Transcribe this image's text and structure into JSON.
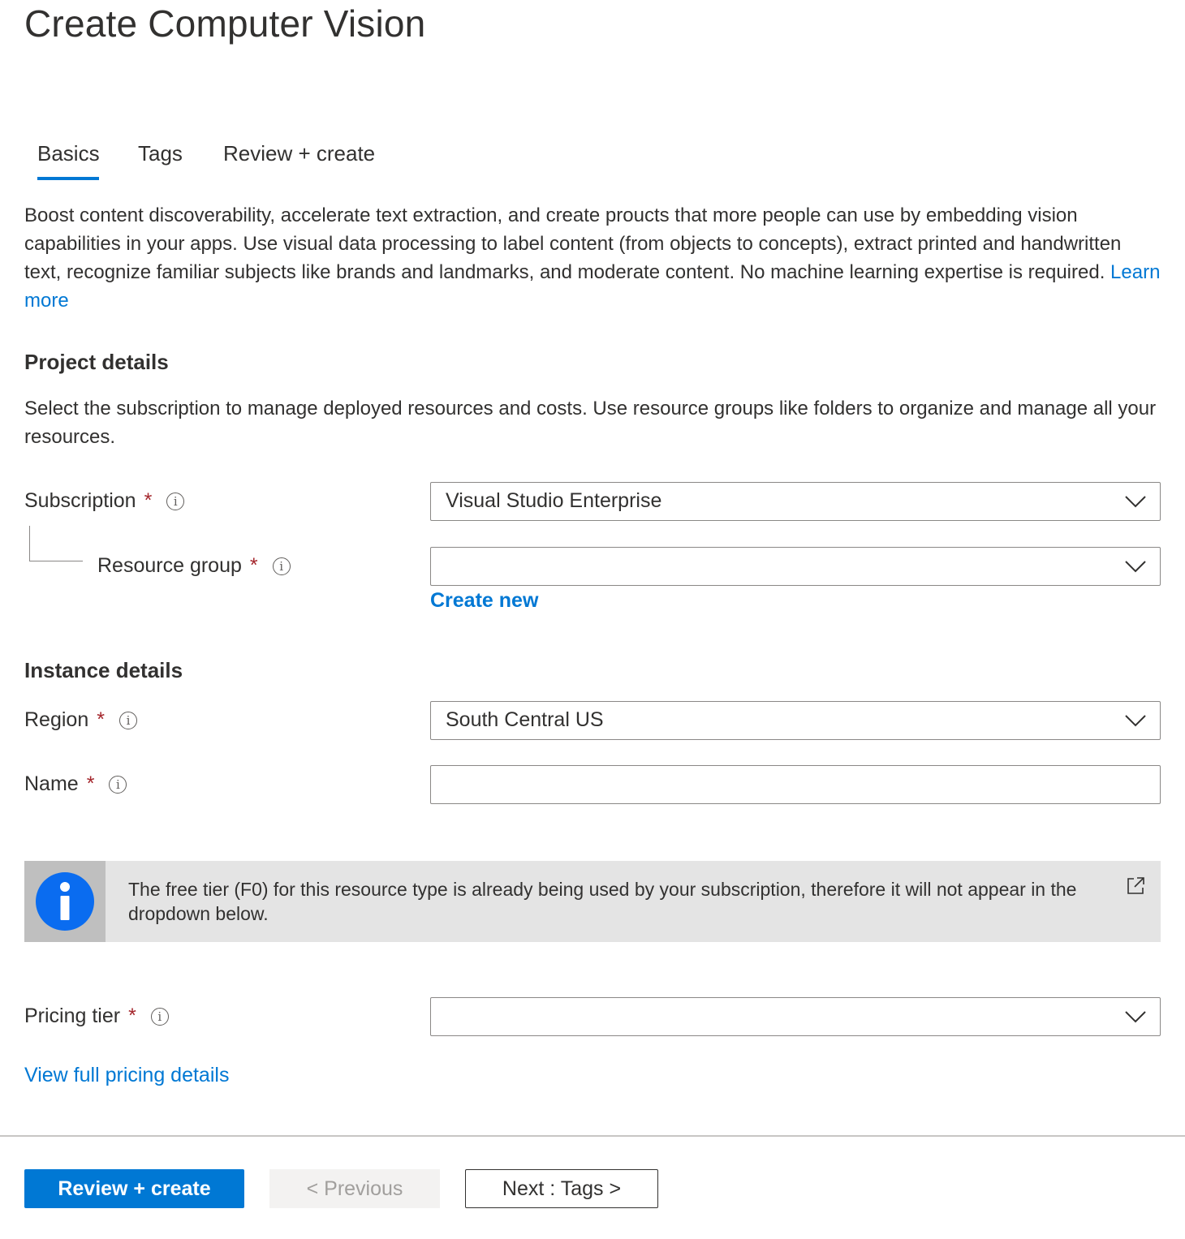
{
  "page": {
    "title": "Create Computer Vision"
  },
  "tabs": [
    {
      "label": "Basics"
    },
    {
      "label": "Tags"
    },
    {
      "label": "Review + create"
    }
  ],
  "intro": {
    "text": "Boost content discoverability, accelerate text extraction, and create proucts that more people can use by embedding vision capabilities in your apps. Use visual data processing to label content (from objects to concepts), extract printed and handwritten text, recognize familiar subjects like brands and landmarks, and moderate content. No machine learning expertise is required.",
    "learn_more": "Learn more"
  },
  "project_details": {
    "title": "Project details",
    "description": "Select the subscription to manage deployed resources and costs. Use resource groups like folders to organize and manage all your resources.",
    "subscription": {
      "label": "Subscription",
      "required": "*",
      "value": "Visual Studio Enterprise"
    },
    "resource_group": {
      "label": "Resource group",
      "required": "*",
      "value": "",
      "create_new": "Create new"
    }
  },
  "instance_details": {
    "title": "Instance details",
    "region": {
      "label": "Region",
      "required": "*",
      "value": "South Central US"
    },
    "name": {
      "label": "Name",
      "required": "*",
      "value": ""
    }
  },
  "banner": {
    "text": "The free tier (F0) for this resource type is already being used by your subscription, therefore it will not appear in the dropdown below."
  },
  "pricing": {
    "label": "Pricing tier",
    "required": "*",
    "value": "",
    "view_details": "View full pricing details"
  },
  "footer": {
    "review_create": "Review + create",
    "previous": "< Previous",
    "next": "Next : Tags >"
  },
  "icons": {
    "info": "info-icon",
    "chevron": "chevron-down-icon",
    "external": "external-link-icon"
  },
  "colors": {
    "accent": "#0078d4",
    "required": "#a4262c",
    "text": "#323130"
  }
}
